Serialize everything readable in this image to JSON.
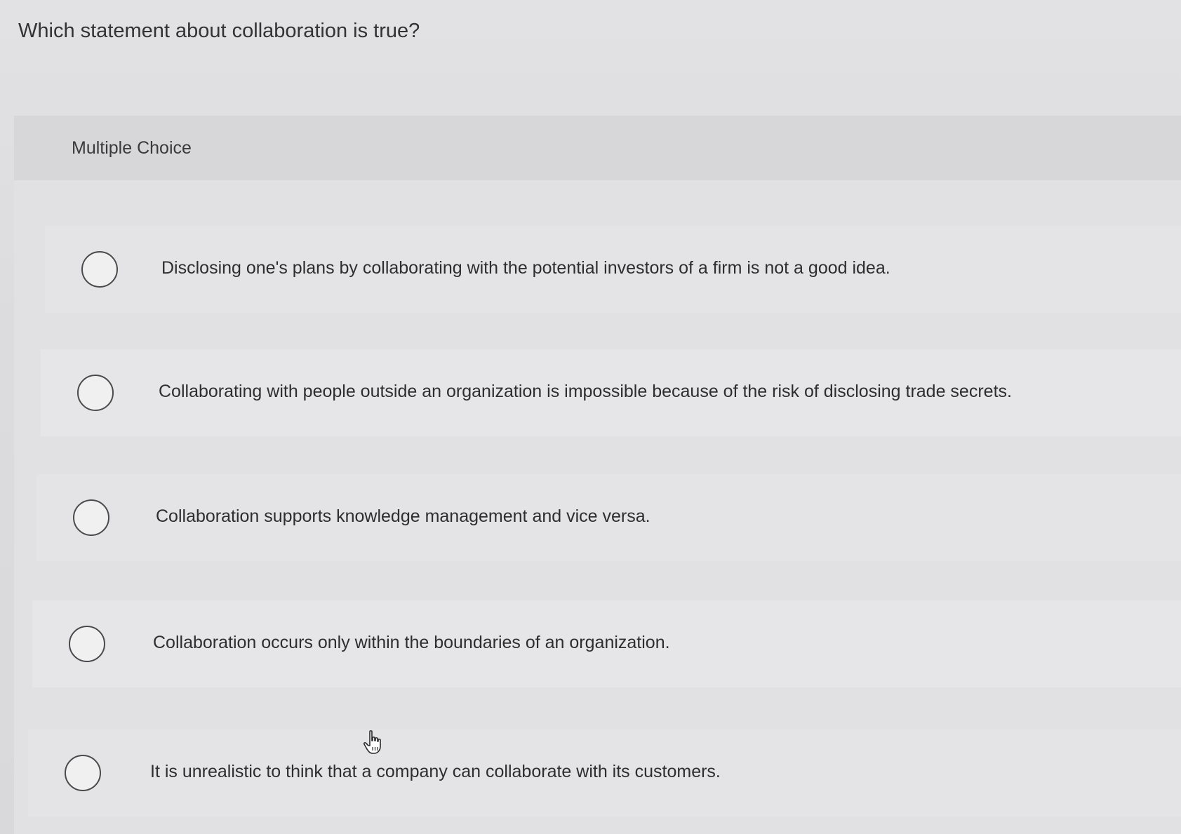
{
  "question": {
    "text": "Which statement about collaboration is true?"
  },
  "multiple_choice": {
    "label": "Multiple Choice",
    "options": [
      {
        "label": "Disclosing one's plans by collaborating with the potential investors of a firm is not a good idea.",
        "selected": false
      },
      {
        "label": "Collaborating with people outside an organization is impossible because of the risk of disclosing trade secrets.",
        "selected": false
      },
      {
        "label": "Collaboration supports knowledge management and vice versa.",
        "selected": false
      },
      {
        "label": "Collaboration occurs only within the boundaries of an organization.",
        "selected": false
      },
      {
        "label": "It is unrealistic to think that a company can collaborate with its customers.",
        "selected": false
      }
    ]
  },
  "icons": {
    "radio": "radio-button-empty-icon",
    "cursor": "hand-pointer-cursor-icon"
  }
}
